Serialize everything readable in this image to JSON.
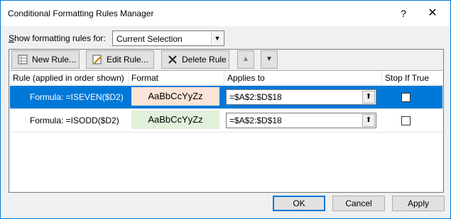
{
  "window": {
    "title": "Conditional Formatting Rules Manager",
    "help": "?",
    "close": "✕"
  },
  "show_rules": {
    "label_prefix": "S",
    "label_rest": "how formatting rules for:",
    "selected": "Current Selection"
  },
  "toolbar": {
    "new_rule": "New Rule...",
    "edit_rule": "Edit Rule...",
    "delete_rule": "Delete Rule"
  },
  "grid": {
    "headers": [
      "Rule (applied in order shown)",
      "Format",
      "Applies to",
      "Stop If True"
    ],
    "rows": [
      {
        "rule": "Formula: =ISEVEN($D2)",
        "format": "AaBbCcYyZz",
        "format_bg": "#fce4d6",
        "applies_to": "=$A$2:$D$18",
        "stop_if_true": false,
        "selected": true
      },
      {
        "rule": "Formula: =ISODD($D2)",
        "format": "AaBbCcYyZz",
        "format_bg": "#e2efda",
        "applies_to": "=$A$2:$D$18",
        "stop_if_true": false,
        "selected": false
      }
    ]
  },
  "buttons": {
    "ok": "OK",
    "cancel": "Cancel",
    "apply": "Apply"
  },
  "colors": {
    "accent": "#0078d7"
  }
}
